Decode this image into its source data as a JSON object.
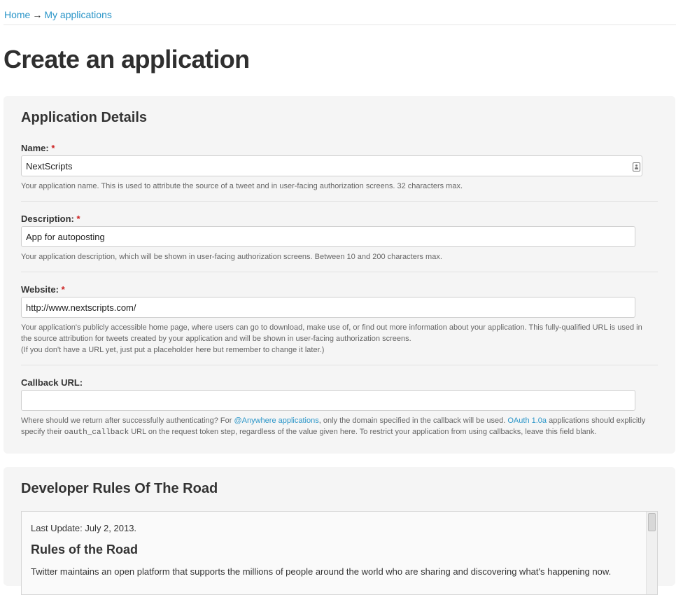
{
  "breadcrumb": {
    "home": "Home",
    "separator": "→",
    "current": "My applications"
  },
  "page_title": "Create an application",
  "details": {
    "heading": "Application Details",
    "required_mark": "*",
    "name": {
      "label": "Name:",
      "value": "NextScripts",
      "help": "Your application name. This is used to attribute the source of a tweet and in user-facing authorization screens. 32 characters max.",
      "icon": "contact-card-icon"
    },
    "description": {
      "label": "Description:",
      "value": "App for autoposting",
      "help": "Your application description, which will be shown in user-facing authorization screens. Between 10 and 200 characters max."
    },
    "website": {
      "label": "Website:",
      "value": "http://www.nextscripts.com/",
      "help_line1": "Your application's publicly accessible home page, where users can go to download, make use of, or find out more information about your application. This fully-qualified URL is used in the source attribution for tweets created by your application and will be shown in user-facing authorization screens.",
      "help_line2": "(If you don't have a URL yet, just put a placeholder here but remember to change it later.)"
    },
    "callback": {
      "label": "Callback URL:",
      "value": "",
      "help_part1": "Where should we return after successfully authenticating? For ",
      "help_link1": "@Anywhere applications",
      "help_part2": ", only the domain specified in the callback will be used. ",
      "help_link2": "OAuth 1.0a",
      "help_part3": " applications should explicitly specify their ",
      "help_code": "oauth_callback",
      "help_part4": " URL on the request token step, regardless of the value given here. To restrict your application from using callbacks, leave this field blank."
    }
  },
  "rules": {
    "heading": "Developer Rules Of The Road",
    "last_update": "Last Update: July 2, 2013.",
    "subheading": "Rules of the Road",
    "text": "Twitter maintains an open platform that supports the millions of people around the world who are sharing and discovering what's happening now."
  },
  "colors": {
    "link": "#2a95c8",
    "required": "#cc1f1f",
    "panel_background": "#f5f5f5"
  }
}
